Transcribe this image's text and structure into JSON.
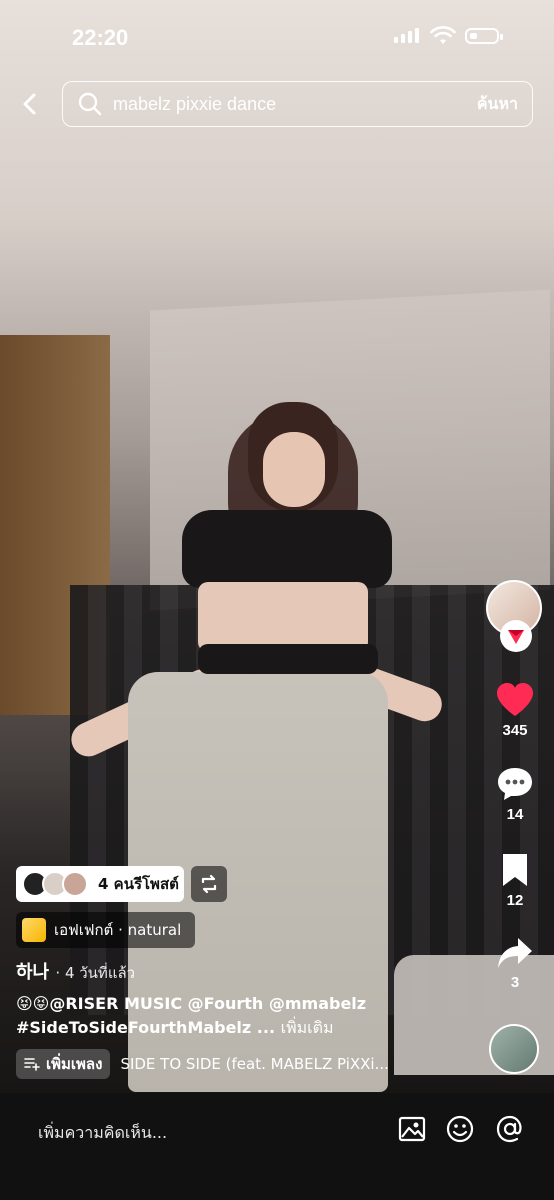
{
  "status_bar": {
    "time": "22:20",
    "battery_level": 0.25
  },
  "search": {
    "query": "mabelz pixxie dance",
    "submit_label": "ค้นหา"
  },
  "right_rail": {
    "likes": "345",
    "comments": "14",
    "saves": "12",
    "shares": "3"
  },
  "overlay": {
    "repost_label": "4 คนรีโพสต์",
    "effect_label": "เอฟเฟกต์ · natural",
    "author": "하나",
    "time_ago": "· 4 วันที่แล้ว",
    "caption_line1": "😝😝@RISER MUSIC @Fourth @mmabelz",
    "caption_line2": "#SideToSideFourthMabelz ...",
    "caption_more": "เพิ่มเติม",
    "add_song_label": "เพิ่มเพลง",
    "music_title": "SIDE TO SIDE (feat. MABELZ PiXXi..."
  },
  "comment_bar": {
    "placeholder": "เพิ่มความคิดเห็น..."
  },
  "colors": {
    "like_red": "#ff2b54",
    "bar_bg": "#111111"
  }
}
